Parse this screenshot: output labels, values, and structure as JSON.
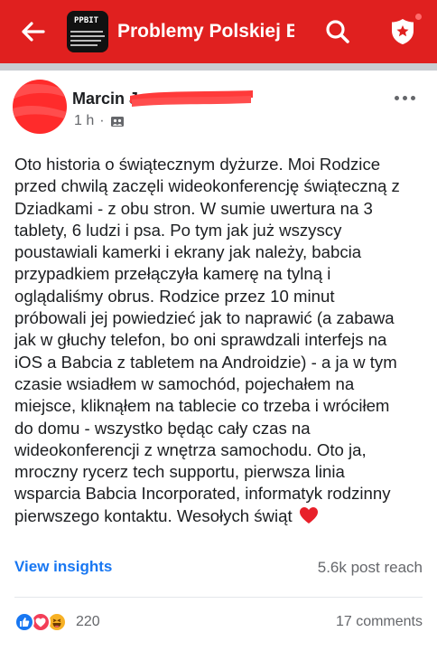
{
  "header": {
    "group_title": "Problemy Polskiej Br…",
    "thumb_logo": "PPBIT",
    "back_icon": "arrow-left-icon",
    "search_icon": "search-icon",
    "badge_icon": "shield-star-icon",
    "colors": {
      "bar": "#e0201f",
      "text": "#ffffff"
    }
  },
  "post": {
    "author": "Marcin J",
    "time": "1 h",
    "separator": "·",
    "privacy_icon": "group-photo-icon",
    "lines": [
      "Oto historia o świątecznym dyżurze. Moi Rodzice",
      "przed chwilą zaczęli wideokonferencję świąteczną z",
      "Dziadkami - z obu stron. W sumie uwertura na 3",
      "tablety, 6 ludzi i psa. Po tym jak już wszyscy",
      "poustawiali kamerki i ekrany jak należy, babcia",
      "przypadkiem przełączyła kamerę na tylną i",
      "oglądaliśmy obrus. Rodzice przez 10 minut",
      "próbowali jej powiedzieć jak to naprawić (a zabawa",
      "jak w głuchy telefon, bo oni sprawdzali interfejs na",
      "iOS a Babcia z tabletem na Androidzie) - a ja w tym",
      "czasie wsiadłem w samochód, pojechałem na",
      "miejsce, kliknąłem na tablecie co trzeba i wróciłem",
      "do domu - wszystko będąc cały czas na",
      "wideokonferencji z wnętrza samochodu. Oto ja,",
      "mroczny rycerz tech supportu, pierwsza linia",
      "wsparcia Babcia Incorporated, informatyk rodzinny",
      "pierwszego kontaktu. Wesołych świąt"
    ],
    "emoji": "❤️"
  },
  "insights": {
    "link": "View insights",
    "reach": "5.6k post reach"
  },
  "engagement": {
    "reaction_icons": [
      "like-icon",
      "love-icon",
      "haha-icon"
    ],
    "reaction_count": "220",
    "comments": "17 comments"
  }
}
